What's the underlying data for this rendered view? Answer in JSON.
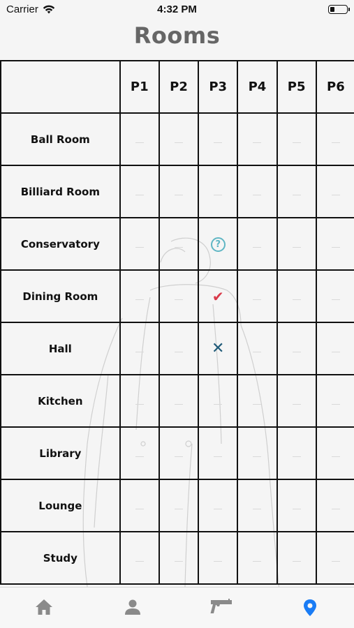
{
  "status_bar": {
    "carrier": "Carrier",
    "time": "4:32 PM"
  },
  "header": {
    "title": "Rooms"
  },
  "grid": {
    "players": [
      "P1",
      "P2",
      "P3",
      "P4",
      "P5",
      "P6"
    ],
    "rooms": [
      {
        "name": "Ball Room",
        "marks": [
          "",
          "",
          "",
          "",
          "",
          ""
        ]
      },
      {
        "name": "Billiard Room",
        "marks": [
          "",
          "",
          "",
          "",
          "",
          ""
        ]
      },
      {
        "name": "Conservatory",
        "marks": [
          "",
          "",
          "question",
          "",
          "",
          ""
        ]
      },
      {
        "name": "Dining Room",
        "marks": [
          "",
          "",
          "check",
          "",
          "",
          ""
        ]
      },
      {
        "name": "Hall",
        "marks": [
          "",
          "",
          "cross",
          "",
          "",
          ""
        ]
      },
      {
        "name": "Kitchen",
        "marks": [
          "",
          "",
          "",
          "",
          "",
          ""
        ]
      },
      {
        "name": "Library",
        "marks": [
          "",
          "",
          "",
          "",
          "",
          ""
        ]
      },
      {
        "name": "Lounge",
        "marks": [
          "",
          "",
          "",
          "",
          "",
          ""
        ]
      },
      {
        "name": "Study",
        "marks": [
          "",
          "",
          "",
          "",
          "",
          ""
        ]
      }
    ]
  },
  "mark_glyphs": {
    "question": "?",
    "check": "✔",
    "cross": "✕"
  },
  "tab_bar": {
    "tabs": [
      {
        "name": "home",
        "icon": "home-icon",
        "active": false
      },
      {
        "name": "suspects",
        "icon": "person-icon",
        "active": false
      },
      {
        "name": "weapons",
        "icon": "gun-icon",
        "active": false
      },
      {
        "name": "rooms",
        "icon": "location-pin-icon",
        "active": true
      }
    ]
  },
  "colors": {
    "active_tab": "#1a7cf5",
    "inactive_tab": "#8a8a8a",
    "question": "#5fb6c4",
    "check": "#d93a4a",
    "cross": "#1f5a78"
  }
}
